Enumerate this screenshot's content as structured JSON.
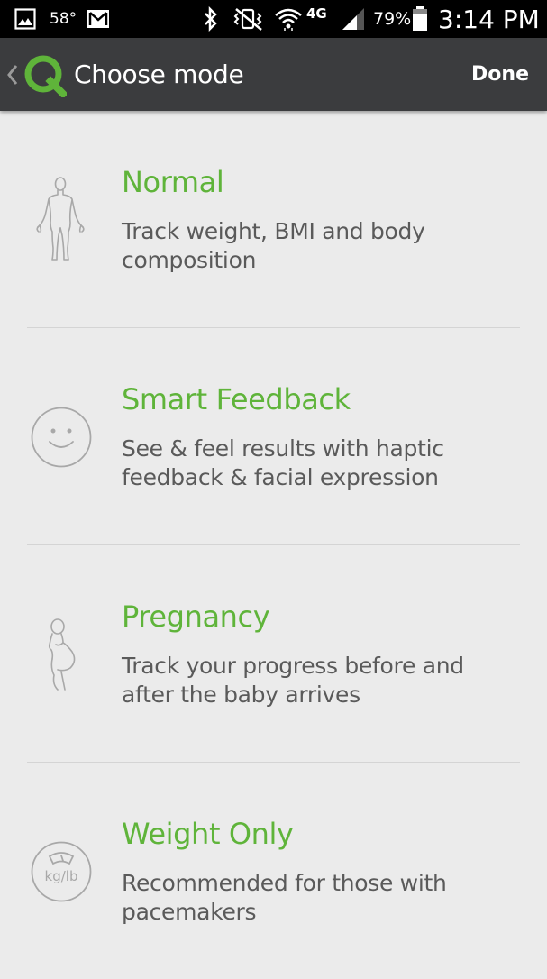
{
  "status_bar": {
    "temperature": "58°",
    "battery": "79%",
    "time": "3:14 PM",
    "network": "4G"
  },
  "app_bar": {
    "title": "Choose mode",
    "done_label": "Done"
  },
  "modes": [
    {
      "title": "Normal",
      "description": "Track weight, BMI and body composition",
      "icon": "body-figure-icon"
    },
    {
      "title": "Smart Feedback",
      "description": "See & feel results with haptic feedback & facial expression",
      "icon": "smiley-face-icon"
    },
    {
      "title": "Pregnancy",
      "description": "Track your progress before and after the baby arrives",
      "icon": "pregnant-figure-icon"
    },
    {
      "title": "Weight Only",
      "description": "Recommended for those with pacemakers",
      "icon": "scale-icon",
      "icon_text": "kg/lb"
    }
  ],
  "colors": {
    "accent": "#5fb43a",
    "app_bar": "#3b3c3e",
    "background": "#ebebeb"
  }
}
